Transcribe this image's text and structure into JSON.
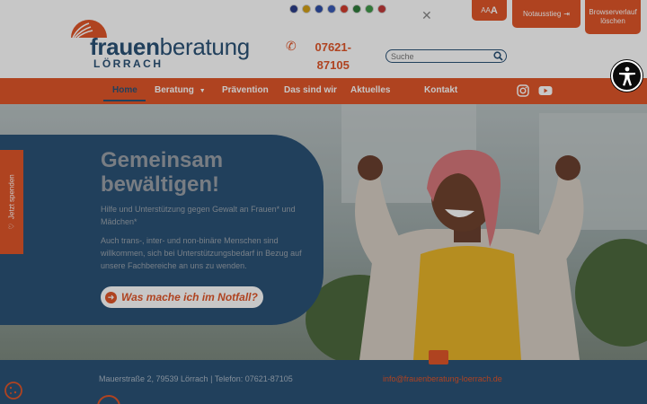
{
  "logo": {
    "brand_bold": "frauen",
    "brand_regular": "beratung",
    "city": "LÖRRACH"
  },
  "languages": [
    {
      "code": "en",
      "color": "#2c3e8a"
    },
    {
      "code": "es",
      "color": "#d4a017"
    },
    {
      "code": "fr",
      "color": "#2f4fa8"
    },
    {
      "code": "ru",
      "color": "#3a5bb8"
    },
    {
      "code": "tr",
      "color": "#d23b2e"
    },
    {
      "code": "sa",
      "color": "#2f7d3c"
    },
    {
      "code": "ir",
      "color": "#3f9a49"
    },
    {
      "code": "hr",
      "color": "#c23a3a"
    }
  ],
  "contact": {
    "phone": "07621-87105"
  },
  "search": {
    "placeholder": "Suche"
  },
  "top_buttons": {
    "font_size_small": "AA",
    "font_size_large": "A",
    "exit": "Notausstieg",
    "history": "Browserverlauf löschen"
  },
  "nav": {
    "items": [
      "Home",
      "Beratung",
      "Prävention",
      "Das sind wir",
      "Aktuelles",
      "Kontakt"
    ],
    "active": "Home"
  },
  "hero": {
    "title": "Gemeinsam bewältigen!",
    "paragraph1": "Hilfe und Unterstützung gegen Gewalt an Frauen* und Mädchen*",
    "paragraph2": "Auch trans-, inter- und non-binäre Menschen sind willkommen, sich bei Unterstützungsbedarf in Bezug auf unsere Fachbereiche an uns zu wenden.",
    "cta": "Was mache ich im Notfall?"
  },
  "side_tab": {
    "label": "Jetzt spenden"
  },
  "footer": {
    "address": "Mauerstraße 2, 79539 Lörrach | Telefon: 07621-87105",
    "email": "info@frauenberatung-loerrach.de"
  },
  "colors": {
    "accent": "#e1562a",
    "brand_blue": "#2b5277"
  }
}
